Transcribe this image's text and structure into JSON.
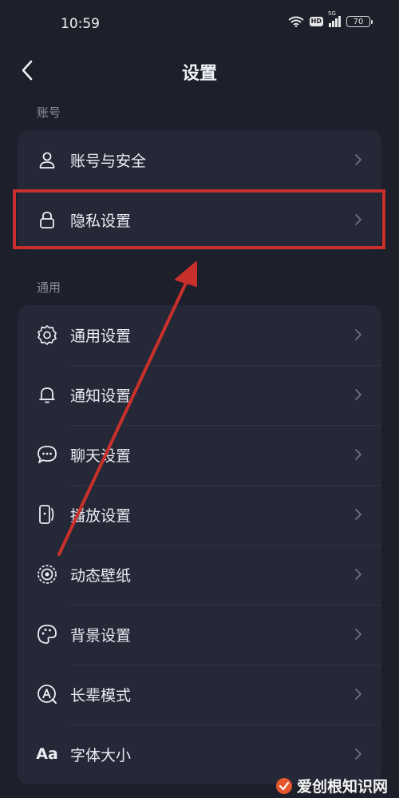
{
  "status_bar": {
    "time": "10:59",
    "hd_badge": "HD",
    "network_badge": "5G",
    "battery_level": "70"
  },
  "nav": {
    "title": "设置"
  },
  "sections": [
    {
      "label": "账号",
      "items": [
        {
          "label": "账号与安全",
          "icon": "user-icon"
        },
        {
          "label": "隐私设置",
          "icon": "lock-icon",
          "highlighted": true
        }
      ]
    },
    {
      "label": "通用",
      "items": [
        {
          "label": "通用设置",
          "icon": "gear-icon"
        },
        {
          "label": "通知设置",
          "icon": "bell-icon"
        },
        {
          "label": "聊天设置",
          "icon": "chat-bubble-icon"
        },
        {
          "label": "播放设置",
          "icon": "play-device-icon"
        },
        {
          "label": "动态壁纸",
          "icon": "dynamic-wallpaper-icon"
        },
        {
          "label": "背景设置",
          "icon": "palette-icon"
        },
        {
          "label": "长辈模式",
          "icon": "elder-mode-icon"
        },
        {
          "label": "字体大小",
          "icon": "font-size-icon",
          "glyph": "Aa"
        }
      ]
    }
  ],
  "watermark": {
    "text": "爱创根知识网"
  },
  "colors": {
    "background": "#1d1f2b",
    "card": "#252836",
    "highlight": "#c9302c",
    "text": "#eceef4",
    "muted": "#8c8f9c"
  }
}
